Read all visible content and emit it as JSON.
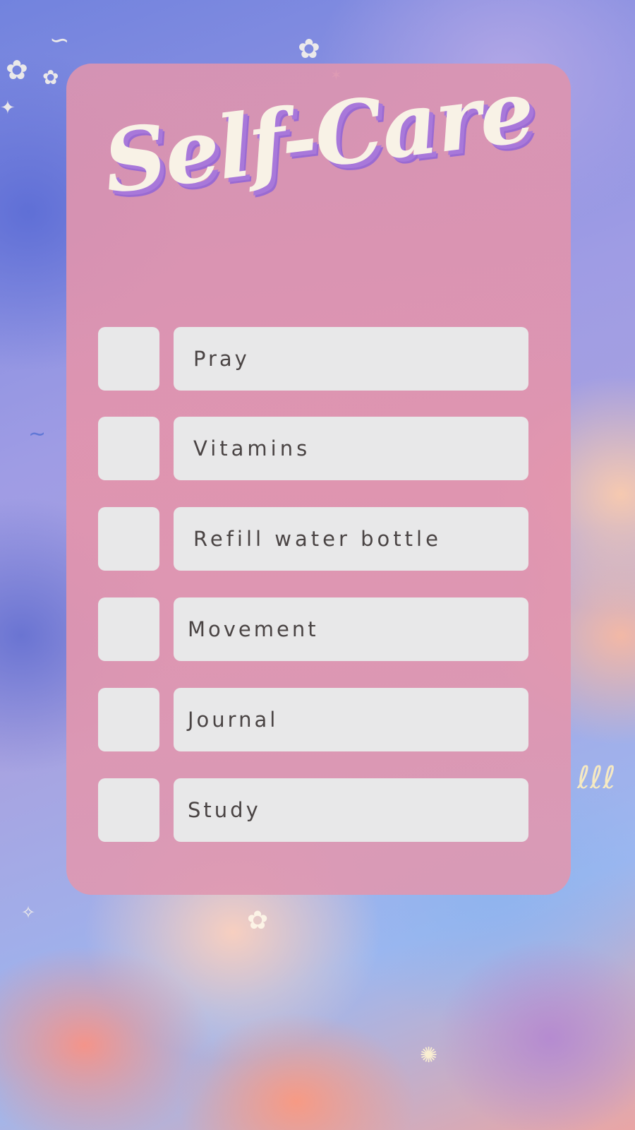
{
  "title": "Self-Care",
  "items": [
    {
      "label": "Pray",
      "checked": false
    },
    {
      "label": "Vitamins",
      "checked": false
    },
    {
      "label": "Refill water bottle",
      "checked": false
    },
    {
      "label": "Movement",
      "checked": false
    },
    {
      "label": "Journal",
      "checked": false
    },
    {
      "label": "Study",
      "checked": false
    }
  ],
  "colors": {
    "card": "#dc94b0",
    "title_fill": "#f8f2e6",
    "title_shadow": "#a878da",
    "box": "#e8e8e9",
    "text": "#4a4444"
  },
  "decorations": [
    "star-icon",
    "swirl-icon",
    "sparkle-icon"
  ]
}
